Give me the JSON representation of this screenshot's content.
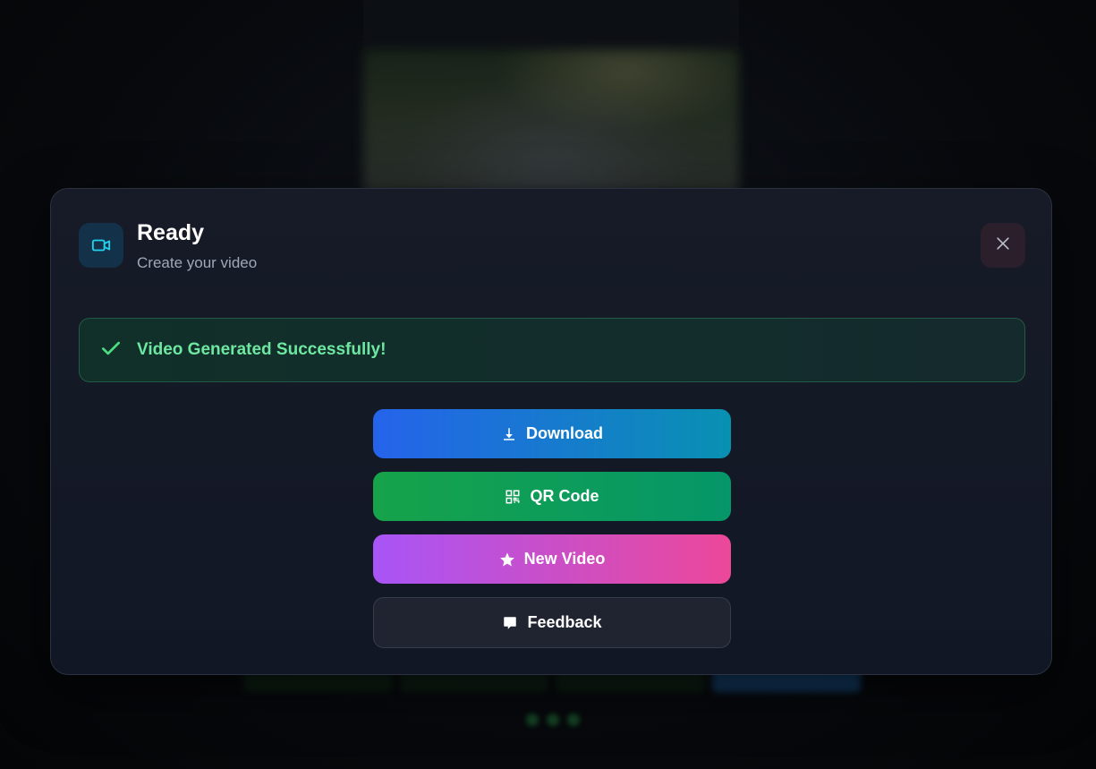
{
  "modal": {
    "title": "Ready",
    "subtitle": "Create your video",
    "header_icon": "video-camera-icon",
    "close_icon": "close-icon"
  },
  "status": {
    "message": "Video Generated Successfully!",
    "icon": "checkmark-icon",
    "color": "#6ee7a0"
  },
  "actions": {
    "download_label": "Download",
    "qr_label": "QR Code",
    "new_video_label": "New Video",
    "feedback_label": "Feedback"
  },
  "colors": {
    "download": [
      "#2563eb",
      "#0891b2"
    ],
    "qr": [
      "#16a34a",
      "#059669"
    ],
    "new_video": [
      "#a855f7",
      "#ec4899"
    ],
    "feedback": "#1f2430",
    "accent_icon": "#22d3ee"
  }
}
